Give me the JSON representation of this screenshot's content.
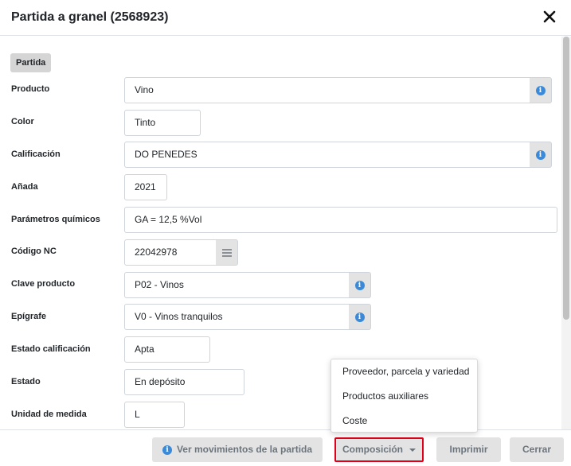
{
  "dialog": {
    "title": "Partida a granel (2568923)"
  },
  "section": {
    "label": "Partida"
  },
  "fields": {
    "producto": {
      "label": "Producto",
      "value": "Vino"
    },
    "color": {
      "label": "Color",
      "value": "Tinto"
    },
    "calificacion": {
      "label": "Calificación",
      "value": "DO PENEDES"
    },
    "anada": {
      "label": "Añada",
      "value": "2021"
    },
    "parametros": {
      "label": "Parámetros químicos",
      "value": "GA = 12,5 %Vol"
    },
    "codigo_nc": {
      "label": "Código NC",
      "value": "22042978"
    },
    "clave_producto": {
      "label": "Clave producto",
      "value": "P02 - Vinos"
    },
    "epigrafe": {
      "label": "Epígrafe",
      "value": "V0 - Vinos tranquilos"
    },
    "estado_calificacion": {
      "label": "Estado calificación",
      "value": "Apta"
    },
    "estado": {
      "label": "Estado",
      "value": "En depósito"
    },
    "unidad_medida": {
      "label": "Unidad de medida",
      "value": "L"
    }
  },
  "footer": {
    "ver_movimientos": "Ver movimientos de la partida",
    "composicion": "Composición",
    "imprimir": "Imprimir",
    "cerrar": "Cerrar"
  },
  "composicion_menu": [
    "Proveedor, parcela y variedad",
    "Productos auxiliares",
    "Coste"
  ],
  "icons": {
    "close": "close-icon",
    "info": "info-icon",
    "list": "list-icon",
    "caret": "caret-down-icon"
  },
  "colors": {
    "info_blue": "#3b8ad9",
    "highlight_red": "#e0001a",
    "addon_gray": "#e3e3e3"
  }
}
